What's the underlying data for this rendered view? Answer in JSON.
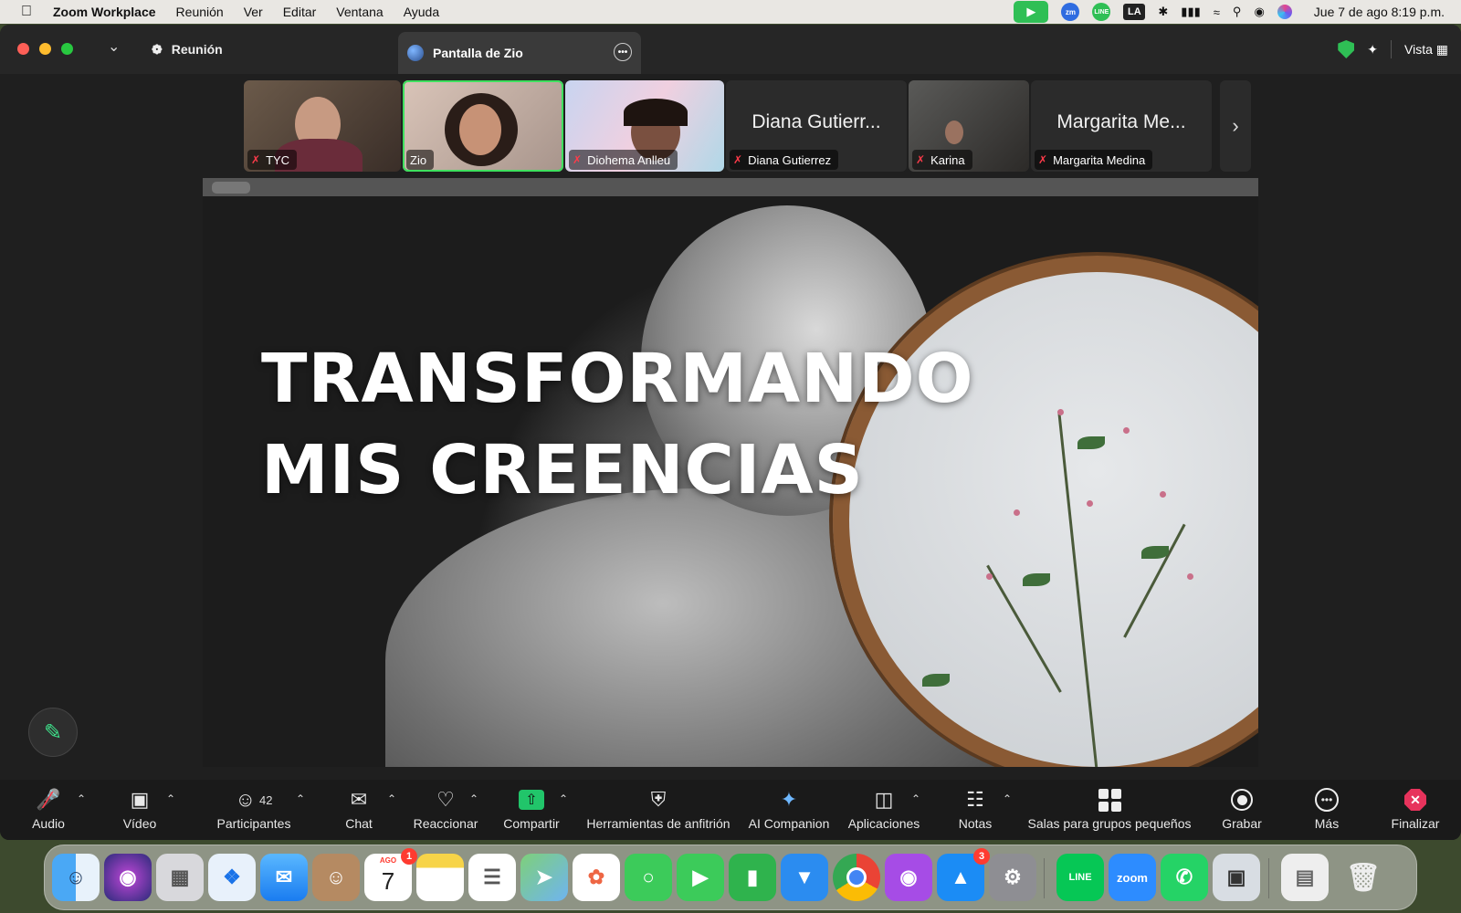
{
  "menubar": {
    "app_name": "Zoom Workplace",
    "items": [
      "Reunión",
      "Ver",
      "Editar",
      "Ventana",
      "Ayuda"
    ],
    "tray": {
      "zm": "zm",
      "line": "LINE",
      "input_source": "LA"
    },
    "clock": "Jue 7 de ago  8:19 p.m."
  },
  "window": {
    "tab_meeting": "Reunión",
    "tab_screen": "Pantalla de Zio",
    "view_label": "Vista"
  },
  "thumbnails": [
    {
      "name": "TYC",
      "type": "video",
      "muted": true
    },
    {
      "name": "Zio",
      "type": "video",
      "muted": false,
      "active": true
    },
    {
      "name": "Diohema Anlleu",
      "type": "video",
      "muted": true
    },
    {
      "name": "Diana Gutierrez",
      "display": "Diana Gutierr...",
      "type": "name",
      "muted": true
    },
    {
      "name": "Karina",
      "type": "video",
      "muted": true
    },
    {
      "name": "Margarita Medina",
      "display": "Margarita Me...",
      "type": "name",
      "muted": true
    }
  ],
  "share": {
    "headline_line1": "TRANSFORMANDO",
    "headline_line2": "MIS CREENCIAS"
  },
  "toolbar": {
    "audio": "Audio",
    "video": "Vídeo",
    "participants": "Participantes",
    "participants_count": "42",
    "chat": "Chat",
    "react": "Reaccionar",
    "share": "Compartir",
    "host_tools": "Herramientas de anfitrión",
    "ai_companion": "AI Companion",
    "apps": "Aplicaciones",
    "notes": "Notas",
    "breakout": "Salas para grupos pequeños",
    "record": "Grabar",
    "more": "Más",
    "end": "Finalizar"
  },
  "dock": {
    "calendar_month": "AGO",
    "calendar_day": "7",
    "calendar_badge": "1",
    "appstore_badge": "3",
    "line_label": "LINE",
    "zoom_label": "zoom"
  },
  "colors": {
    "accent_green": "#3ee05e",
    "share_green": "#21c56a",
    "end_red": "#e7335c",
    "mute_red": "#ff3b4a"
  }
}
